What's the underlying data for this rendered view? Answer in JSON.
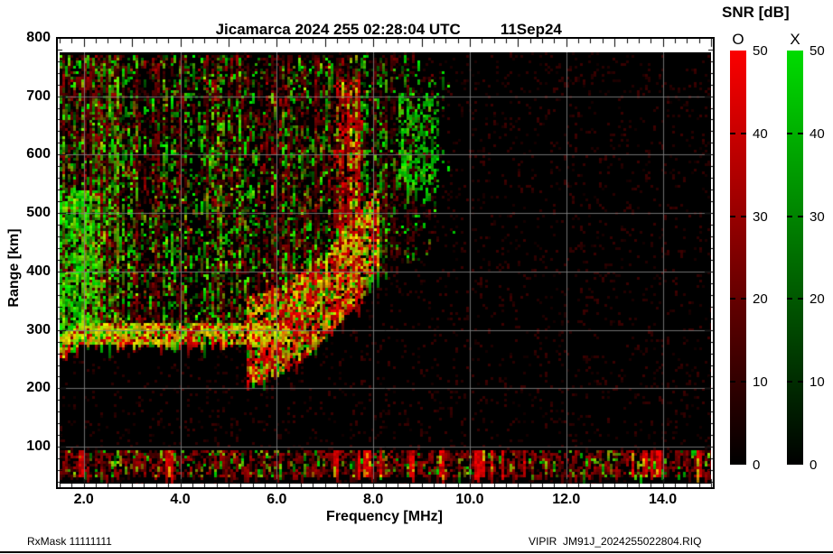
{
  "page": {
    "title_left": "Jicamarca 2024 255 02:28:04 UTC",
    "title_right": "11Sep24",
    "footer_left": "RxMask 11111111",
    "footer_right": "VIPIR  JM91J_2024255022804.RIQ"
  },
  "chart_data": {
    "type": "heatmap",
    "subtype": "VIPIR ionogram: O-mode (red) and X-mode (green) echo SNR vs sounding frequency and virtual range",
    "title": "Jicamarca 2024 255 02:28:04 UTC      11Sep24",
    "xlabel": "Frequency [MHz]",
    "ylabel": "Range [km]",
    "xlim": [
      1.5,
      15.0
    ],
    "ylim": [
      37,
      800
    ],
    "data_top_km": 775,
    "x_major_ticks": [
      2.0,
      4.0,
      6.0,
      8.0,
      10.0,
      12.0,
      14.0
    ],
    "x_tick_labels": [
      "2.0",
      "4.0",
      "6.0",
      "8.0",
      "10.0",
      "12.0",
      "14.0"
    ],
    "x_minor_step": 0.25,
    "y_major_ticks": [
      100,
      200,
      300,
      400,
      500,
      600,
      700,
      800
    ],
    "y_tick_labels": [
      "100",
      "200",
      "300",
      "400",
      "500",
      "600",
      "700",
      "800"
    ],
    "y_minor_step": 20,
    "grid": "on",
    "grid_color": "#828282",
    "plot_background": "#000000",
    "colorbar": {
      "title": "SNR [dB]",
      "min": 0,
      "max": 50,
      "ticks": [
        0,
        10,
        20,
        30,
        40,
        50
      ],
      "tick_labels": [
        "0",
        "10",
        "20",
        "30",
        "40",
        "50"
      ],
      "bars": [
        {
          "label": "O",
          "top_color": "#fb0000",
          "bottom_color": "#000000"
        },
        {
          "label": "X",
          "top_color": "#00dc00",
          "bottom_color": "#000000"
        }
      ]
    },
    "echo_regions": [
      {
        "id": "background-red-noise",
        "mode": "O",
        "density": 0.09
      },
      {
        "id": "diffuse-spread-f",
        "mode": "O+X",
        "f_range": [
          1.5,
          9.7
        ],
        "km_range": [
          300,
          772
        ],
        "km_lower_edge_rise_start_mhz": 5.8,
        "km_lower_edge_rise_per_mhz": 38,
        "density_o": 0.4,
        "density_x": 0.26,
        "fade_start_mhz": 7.6
      },
      {
        "id": "f-layer-base-trace",
        "mode": "O+X",
        "f_range": [
          1.5,
          6.3
        ],
        "km_center": 293,
        "km_halfwidth": 20,
        "left_dip_mhz": 1.9,
        "left_dip_km": 26
      },
      {
        "id": "f-layer-cusp",
        "mode": "O+X",
        "f_range": [
          5.4,
          8.15
        ],
        "km_rise_pow": 1.75,
        "km_rise_scale": 33,
        "km_above": 60,
        "km_below": 90,
        "density_o": 0.65,
        "density_x": 0.3
      },
      {
        "id": "left-x-mode-patch",
        "mode": "X",
        "f_range": [
          1.5,
          2.35
        ],
        "km_range": [
          275,
          540
        ],
        "density": 0.55
      },
      {
        "id": "high-x-mode-patch",
        "mode": "X",
        "f_range": [
          8.5,
          9.35
        ],
        "km_range": [
          540,
          705
        ],
        "density": 0.4
      },
      {
        "id": "o-mode-stripe-cluster",
        "mode": "O",
        "f_range": [
          7.2,
          7.8
        ],
        "km_range": [
          330,
          730
        ],
        "density": 0.5
      },
      {
        "id": "e-region-interference-band",
        "mode": "O+X",
        "f_range": [
          1.5,
          15.0
        ],
        "km_range": [
          48,
          95
        ],
        "density_o": 0.45,
        "density_x": 0.1,
        "bright_stripes": 22
      }
    ],
    "render_seed": 20242550
  }
}
